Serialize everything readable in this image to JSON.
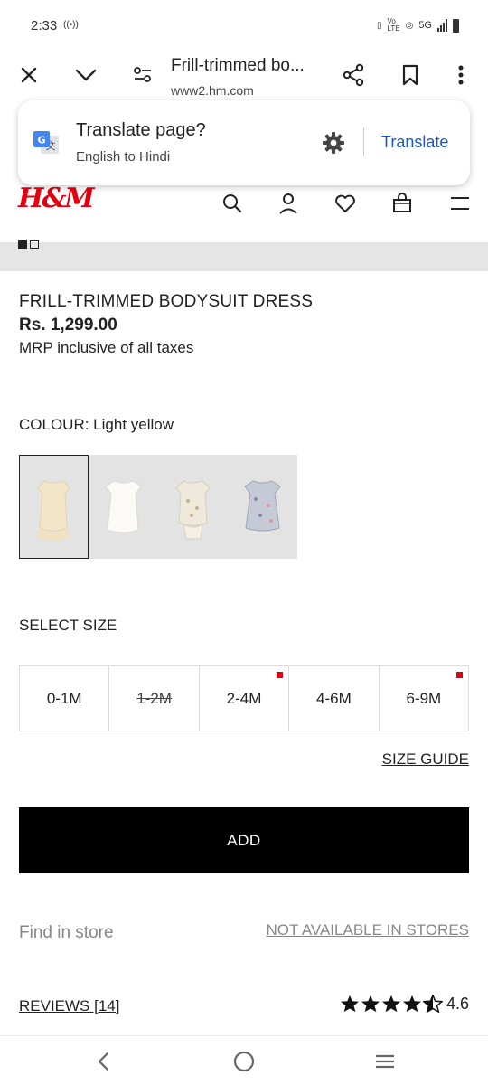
{
  "status_bar": {
    "time": "2:33",
    "network": "5G",
    "volte_label": "VoLTE"
  },
  "browser": {
    "page_title": "Frill-trimmed bo...",
    "url": "www2.hm.com"
  },
  "translate_prompt": {
    "title": "Translate page?",
    "subtitle": "English to Hindi",
    "action_label": "Translate"
  },
  "brand": {
    "logo_text": "H&M",
    "logo_color": "#e50010"
  },
  "header_icons": [
    "search-icon",
    "account-icon",
    "favorites-heart-icon",
    "shopping-bag-icon",
    "menu-icon"
  ],
  "product": {
    "name": "FRILL-TRIMMED BODYSUIT DRESS",
    "price": "Rs. 1,299.00",
    "tax_note": "MRP inclusive of all taxes",
    "colour_label": "COLOUR: Light yellow"
  },
  "colour_swatches": [
    {
      "name": "Light yellow",
      "color": "#f3e6c8",
      "selected": true
    },
    {
      "name": "White",
      "color": "#f6f4ee",
      "selected": false
    },
    {
      "name": "Cream floral",
      "color": "#efe9dc",
      "selected": false
    },
    {
      "name": "Blue floral",
      "color": "#b9bfd0",
      "selected": false
    }
  ],
  "size_section": {
    "label": "SELECT SIZE",
    "sizes": [
      {
        "label": "0-1M",
        "available": true,
        "low_stock": false
      },
      {
        "label": "1-2M",
        "available": false,
        "low_stock": false
      },
      {
        "label": "2-4M",
        "available": true,
        "low_stock": true
      },
      {
        "label": "4-6M",
        "available": true,
        "low_stock": false
      },
      {
        "label": "6-9M",
        "available": true,
        "low_stock": true
      }
    ],
    "size_guide_label": "SIZE GUIDE"
  },
  "actions": {
    "add_label": "ADD",
    "find_in_store_label": "Find in store",
    "store_status": "NOT AVAILABLE IN STORES"
  },
  "reviews": {
    "label": "REVIEWS [14]",
    "rating": "4.6",
    "stars_filled": 4,
    "stars_half": 1
  },
  "colors": {
    "accent_blue": "#1a56c8",
    "add_button": "#000000",
    "low_stock_dot": "#e50010"
  }
}
